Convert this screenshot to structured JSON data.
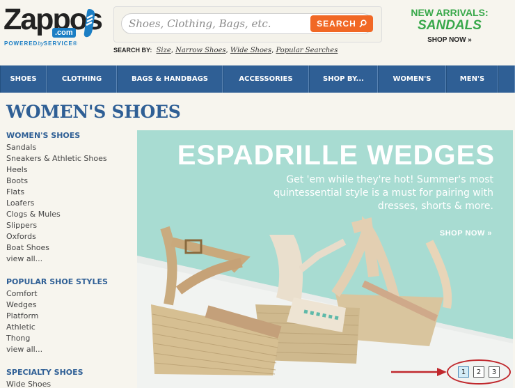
{
  "logo": {
    "word": "Zappos",
    "dotcom": ".com",
    "tagline_prefix": "POWERED",
    "tagline_by": "by",
    "tagline_suffix": "SERVICE",
    "reg": "®",
    "icon": "shoe-logo-icon"
  },
  "search": {
    "placeholder": "Shoes, Clothing, Bags, etc.",
    "button_label": "SEARCH",
    "button_icon": "search-icon",
    "search_by_label": "SEARCH BY:",
    "links": [
      "Size",
      "Narrow Shoes",
      "Wide Shoes",
      "Popular Searches"
    ]
  },
  "promo": {
    "line1": "NEW ARRIVALS:",
    "line2": "SANDALS",
    "link": "SHOP NOW »"
  },
  "nav": {
    "items": [
      "SHOES",
      "CLOTHING",
      "BAGS & HANDBAGS",
      "ACCESSORIES",
      "SHOP BY...",
      "WOMEN'S",
      "MEN'S"
    ]
  },
  "page": {
    "title": "WOMEN'S SHOES"
  },
  "sidebar": {
    "groups": [
      {
        "heading": "WOMEN'S SHOES",
        "items": [
          "Sandals",
          "Sneakers & Athletic Shoes",
          "Heels",
          "Boots",
          "Flats",
          "Loafers",
          "Clogs & Mules",
          "Slippers",
          "Oxfords",
          "Boat Shoes",
          "view all..."
        ]
      },
      {
        "heading": "POPULAR SHOE STYLES",
        "items": [
          "Comfort",
          "Wedges",
          "Platform",
          "Athletic",
          "Thong",
          "view all..."
        ]
      },
      {
        "heading": "SPECIALTY SHOES",
        "items": [
          "Wide Shoes"
        ]
      }
    ]
  },
  "banner": {
    "title": "ESPADRILLE WEDGES",
    "text": "Get 'em while they're hot! Summer's most quintessential style is a must for pairing with dresses, shorts & more.",
    "shop_link": "SHOP NOW »"
  },
  "pager": {
    "pages": [
      "1",
      "2",
      "3"
    ],
    "active": 1
  },
  "colors": {
    "brand_blue": "#2f5f95",
    "search_orange": "#f16825",
    "promo_green": "#38a84a",
    "banner_mint": "#a8dcd2",
    "annotation_red": "#c0282d"
  }
}
